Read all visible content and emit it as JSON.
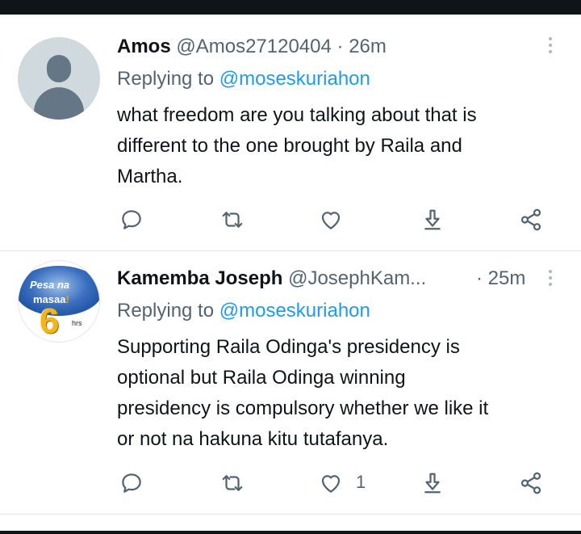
{
  "tweets": [
    {
      "name": "Amos",
      "handle": "@Amos27120404",
      "separator": "·",
      "time": "26m",
      "replying_prefix": "Replying to",
      "replying_to": "@moseskuriahon",
      "text_lines": [
        "what freedom are you talking about that is",
        "different to the one brought by Raila and",
        "Martha."
      ],
      "avatar": "default-avatar-icon",
      "likes": ""
    },
    {
      "name": "Kamemba Joseph",
      "handle": "@JosephKam...",
      "separator": "·",
      "time": "25m",
      "replying_prefix": "Replying to",
      "replying_to": "@moseskuriahon",
      "text_lines": [
        "Supporting Raila Odinga's presidency is",
        "optional but Raila Odinga winning",
        "presidency is compulsory whether we like it",
        "or not na hakuna kitu tutafanya."
      ],
      "avatar_text": {
        "line1": "Pesa na",
        "line2a": "masaa",
        "line2b": "!",
        "number": "6",
        "unit": "hrs"
      },
      "likes": "1"
    }
  ],
  "icons": [
    "reply-icon",
    "retweet-icon",
    "like-icon",
    "share-icon",
    "share-network-icon",
    "more-icon"
  ],
  "colors": {
    "link": "#1d9bf0",
    "secondary": "#536471",
    "primary": "#0f1419",
    "divider": "#e6e6e6"
  }
}
